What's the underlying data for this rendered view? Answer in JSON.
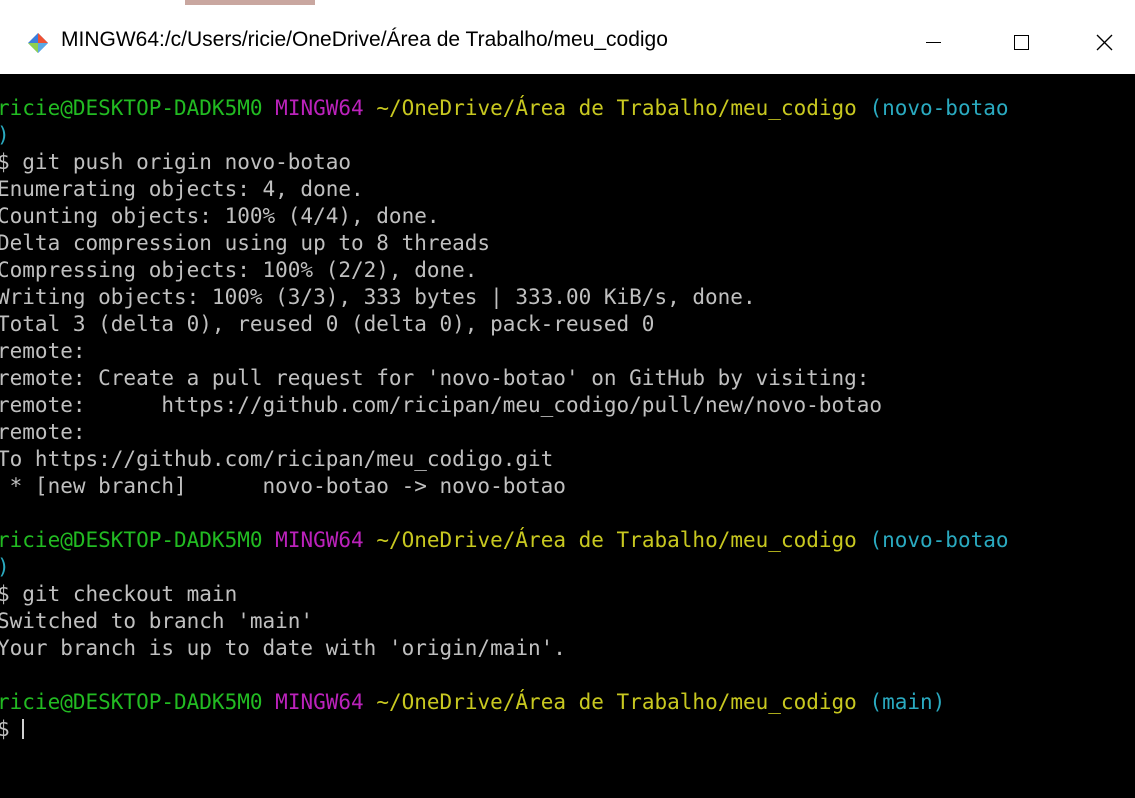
{
  "window": {
    "title": "MINGW64:/c/Users/ricie/OneDrive/Área de Trabalho/meu_codigo",
    "icon": "git-bash-icon",
    "controls": {
      "minimize": "minimize-icon",
      "maximize": "maximize-icon",
      "close": "close-icon",
      "close_glyph": "✕"
    }
  },
  "colors": {
    "user": "#22bb22",
    "host": "#bb22bb",
    "path": "#c8c820",
    "branch": "#2aaac0",
    "text": "#c0c0c0",
    "background": "#000000"
  },
  "terminal": {
    "prompt1": {
      "user": "ricie@DESKTOP-DADK5M0",
      "host": "MINGW64",
      "path": "~/OneDrive/Área de Trabalho/meu_codigo",
      "branch_open": "(novo-botao",
      "branch_close": ")"
    },
    "cmd1": "$ git push origin novo-botao",
    "output1": [
      "Enumerating objects: 4, done.",
      "Counting objects: 100% (4/4), done.",
      "Delta compression using up to 8 threads",
      "Compressing objects: 100% (2/2), done.",
      "Writing objects: 100% (3/3), 333 bytes | 333.00 KiB/s, done.",
      "Total 3 (delta 0), reused 0 (delta 0), pack-reused 0",
      "remote:",
      "remote: Create a pull request for 'novo-botao' on GitHub by visiting:",
      "remote:      https://github.com/ricipan/meu_codigo/pull/new/novo-botao",
      "remote:",
      "To https://github.com/ricipan/meu_codigo.git",
      " * [new branch]      novo-botao -> novo-botao"
    ],
    "prompt2": {
      "user": "ricie@DESKTOP-DADK5M0",
      "host": "MINGW64",
      "path": "~/OneDrive/Área de Trabalho/meu_codigo",
      "branch_open": "(novo-botao",
      "branch_close": ")"
    },
    "cmd2": "$ git checkout main",
    "output2": [
      "Switched to branch 'main'",
      "Your branch is up to date with 'origin/main'."
    ],
    "prompt3": {
      "user": "ricie@DESKTOP-DADK5M0",
      "host": "MINGW64",
      "path": "~/OneDrive/Área de Trabalho/meu_codigo",
      "branch": "(main)"
    },
    "cmd3": "$ "
  }
}
